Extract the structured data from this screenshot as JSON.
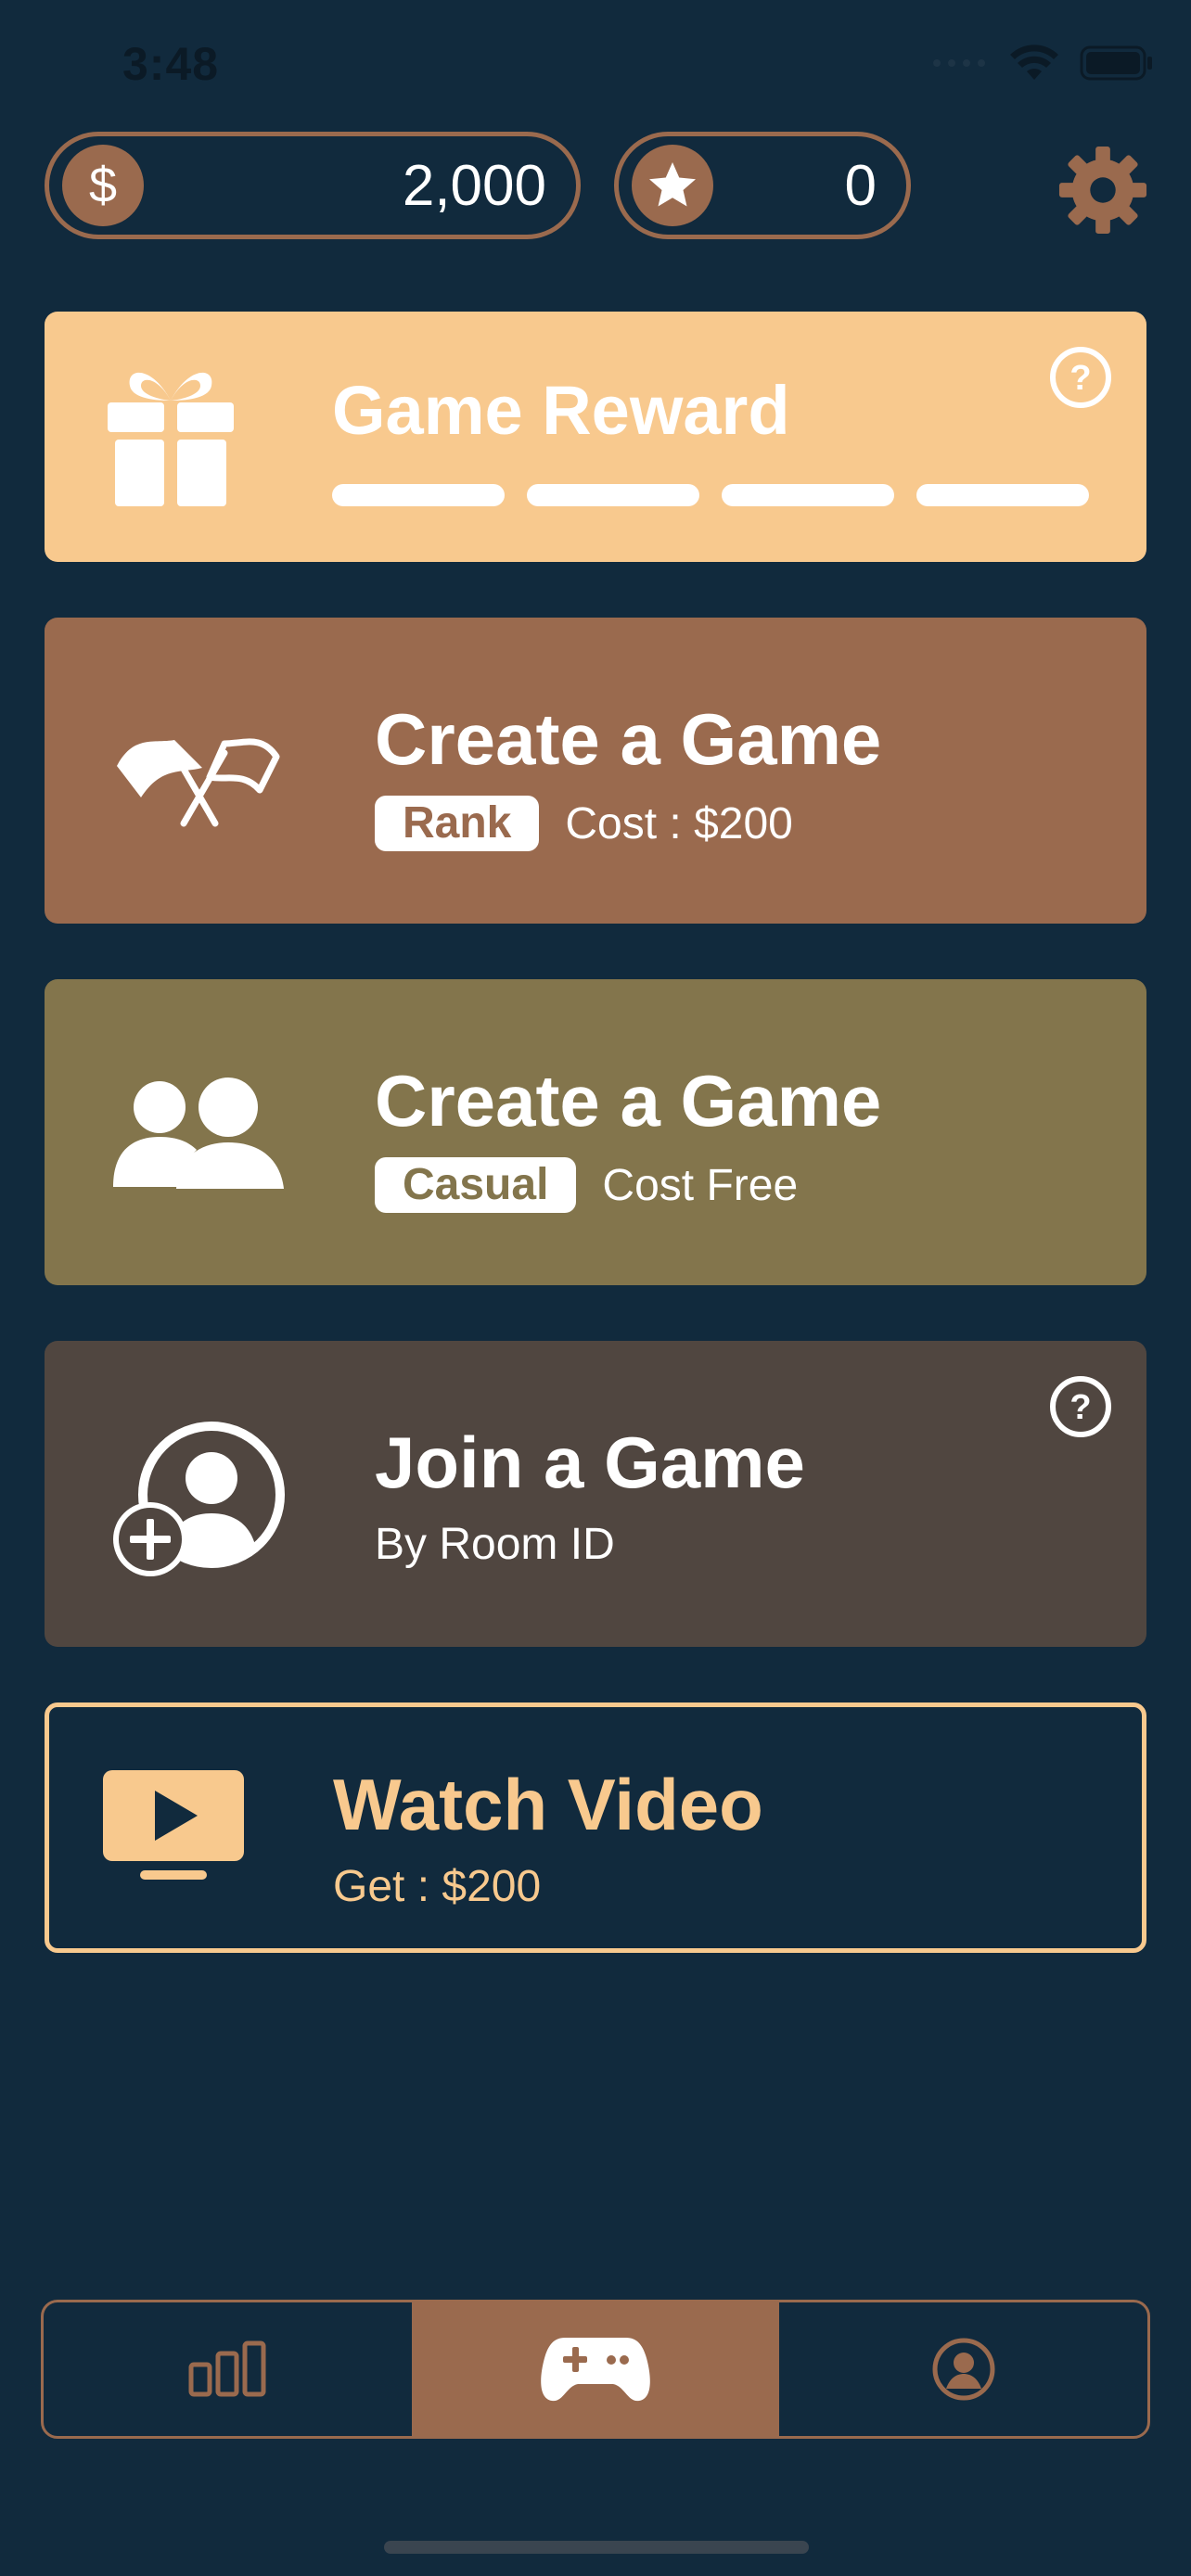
{
  "status_bar": {
    "time": "3:48"
  },
  "wallet": {
    "coins": "2,000",
    "stars": "0"
  },
  "cards": {
    "reward": {
      "title": "Game Reward",
      "progress_segments": 4
    },
    "rank_game": {
      "title": "Create a Game",
      "tag": "Rank",
      "detail": "Cost : $200"
    },
    "casual_game": {
      "title": "Create a Game",
      "tag": "Casual",
      "detail": "Cost Free"
    },
    "join_game": {
      "title": "Join a Game",
      "detail": "By Room ID"
    },
    "watch_video": {
      "title": "Watch Video",
      "detail": "Get : $200"
    }
  },
  "tabs": [
    {
      "name": "leaderboard",
      "icon": "bar-chart-icon",
      "active": false
    },
    {
      "name": "games",
      "icon": "gamepad-icon",
      "active": true
    },
    {
      "name": "profile",
      "icon": "user-icon",
      "active": false
    }
  ],
  "colors": {
    "background": "#112a3d",
    "accent_brown": "#9a6a4e",
    "reward_peach": "#f8c98e",
    "casual_olive": "#83754c",
    "join_dark": "#504640",
    "video_gold": "#f8c98e"
  }
}
